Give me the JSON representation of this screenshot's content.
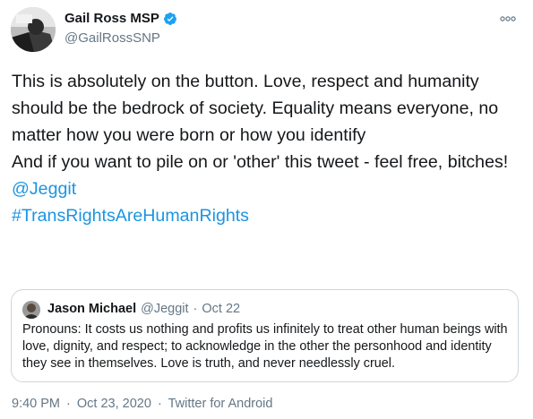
{
  "author": {
    "name": "Gail Ross MSP",
    "handle": "@GailRossSNP"
  },
  "icons": {
    "avatar": "avatar-photo",
    "verified": "verified-badge-icon",
    "more": "more-options-icon"
  },
  "colors": {
    "link": "#1b95e0",
    "secondary_text": "#657786",
    "verified": "#1da1f2",
    "border": "#ccd6dd"
  },
  "tweet": {
    "line1": "This is absolutely on the button. Love, respect and humanity should be the bedrock of society. Equality means everyone, no matter how you were born or how you identify",
    "line2": "And if you want to pile on or 'other' this tweet - feel free, bitches!",
    "mention": "@Jeggit",
    "hashtag": "#TransRightsAreHumanRights"
  },
  "quote": {
    "name": "Jason Michael",
    "handle": "@Jeggit",
    "dot": "·",
    "date": "Oct 22",
    "text": "Pronouns: It costs us nothing and profits us infinitely to treat other human beings with love, dignity, and respect; to acknowledge in the other the personhood and identity they see in themselves. Love is truth, and never needlessly cruel."
  },
  "meta": {
    "time": "9:40 PM",
    "dot1": "·",
    "date": "Oct 23, 2020",
    "dot2": "·",
    "source": "Twitter for Android"
  }
}
